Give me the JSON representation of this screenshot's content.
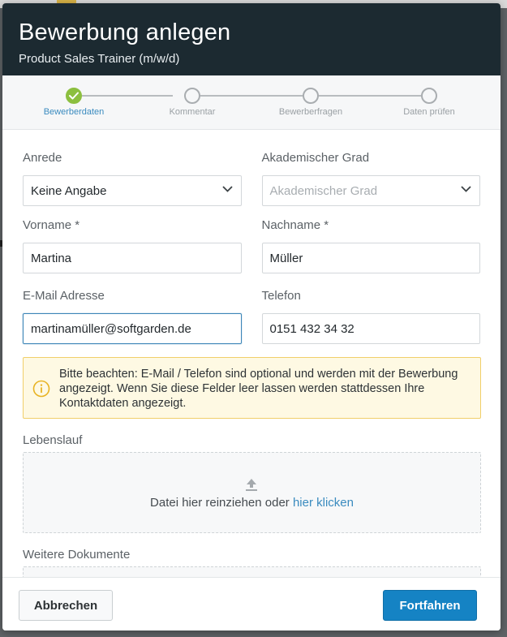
{
  "modal": {
    "title": "Bewerbung anlegen",
    "subtitle": "Product Sales Trainer (m/w/d)"
  },
  "stepper": {
    "steps": [
      {
        "label": "Bewerberdaten",
        "state": "done"
      },
      {
        "label": "Kommentar",
        "state": "pending"
      },
      {
        "label": "Bewerberfragen",
        "state": "pending"
      },
      {
        "label": "Daten prüfen",
        "state": "pending"
      }
    ],
    "accent_color": "#8cbf3f"
  },
  "form": {
    "salutation": {
      "label": "Anrede",
      "value": "Keine Angabe"
    },
    "academic_degree": {
      "label": "Akademischer Grad",
      "value": "",
      "placeholder": "Akademischer Grad"
    },
    "first_name": {
      "label": "Vorname *",
      "value": "Martina"
    },
    "last_name": {
      "label": "Nachname *",
      "value": "Müller"
    },
    "email": {
      "label": "E-Mail Adresse",
      "value": "martinamüller@softgarden.de"
    },
    "phone": {
      "label": "Telefon",
      "value": "0151 432 34 32"
    }
  },
  "notice": {
    "icon": "info-icon",
    "text": "Bitte beachten: E-Mail / Telefon sind optional und werden mit der Bewerbung angezeigt. Wenn Sie diese Felder leer lassen werden stattdessen Ihre Kontaktdaten angezeigt."
  },
  "resume": {
    "label": "Lebenslauf",
    "drop_text": "Datei hier reinziehen oder ",
    "link_text": "hier klicken"
  },
  "more_documents": {
    "label": "Weitere Dokumente"
  },
  "footer": {
    "cancel_label": "Abbrechen",
    "continue_label": "Fortfahren",
    "primary_color": "#1583c4"
  }
}
